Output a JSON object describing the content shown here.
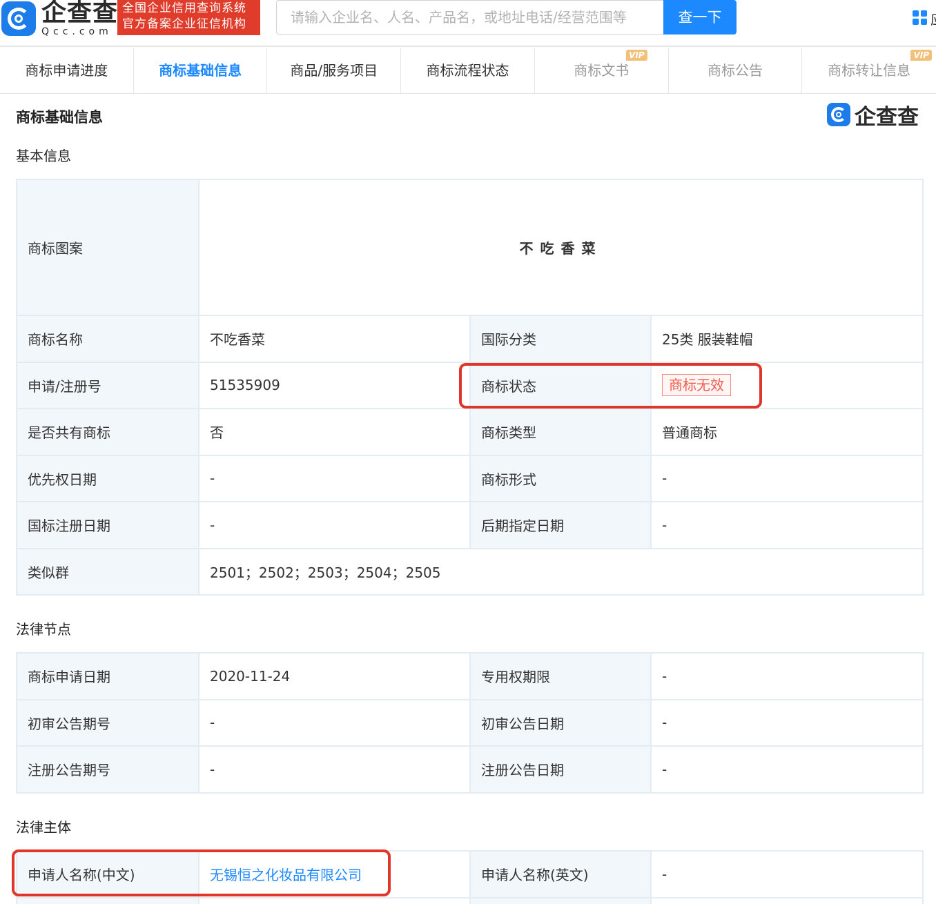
{
  "header": {
    "logo_cn": "企查查",
    "logo_en": "Qcc.com",
    "badge_line1": "全国企业信用查询系统",
    "badge_line2": "官方备案企业征信机构",
    "search_placeholder": "请输入企业名、人名、产品名，或地址电话/经营范围等",
    "search_button": "查一下",
    "cut_text": "应"
  },
  "tabs": [
    {
      "label": "商标申请进度",
      "active": false,
      "vip": false
    },
    {
      "label": "商标基础信息",
      "active": true,
      "vip": false
    },
    {
      "label": "商品/服务项目",
      "active": false,
      "vip": false
    },
    {
      "label": "商标流程状态",
      "active": false,
      "vip": false
    },
    {
      "label": "商标文书",
      "active": false,
      "vip": true
    },
    {
      "label": "商标公告",
      "active": false,
      "vip": false
    },
    {
      "label": "商标转让信息",
      "active": false,
      "vip": true
    }
  ],
  "vip_label": "VIP",
  "page": {
    "title": "商标基础信息",
    "brand_text": "企查查"
  },
  "basic": {
    "title": "基本信息",
    "trademark_image_label": "商标图案",
    "trademark_image_text": "不吃香菜",
    "rows": [
      {
        "l1": "商标名称",
        "v1": "不吃香菜",
        "l2": "国际分类",
        "v2": "25类 服装鞋帽"
      },
      {
        "l1": "申请/注册号",
        "v1": "51535909",
        "l2": "商标状态",
        "v2": "商标无效"
      },
      {
        "l1": "是否共有商标",
        "v1": "否",
        "l2": "商标类型",
        "v2": "普通商标"
      },
      {
        "l1": "优先权日期",
        "v1": "-",
        "l2": "商标形式",
        "v2": "-"
      },
      {
        "l1": "国标注册日期",
        "v1": "-",
        "l2": "后期指定日期",
        "v2": "-"
      }
    ],
    "similar_label": "类似群",
    "similar_value": "2501；2502；2503；2504；2505"
  },
  "legal_nodes": {
    "title": "法律节点",
    "rows": [
      {
        "l1": "商标申请日期",
        "v1": "2020-11-24",
        "l2": "专用权期限",
        "v2": "-"
      },
      {
        "l1": "初审公告期号",
        "v1": "-",
        "l2": "初审公告日期",
        "v2": "-"
      },
      {
        "l1": "注册公告期号",
        "v1": "-",
        "l2": "注册公告日期",
        "v2": "-"
      }
    ]
  },
  "legal_subject": {
    "title": "法律主体",
    "rows": [
      {
        "l1": "申请人名称(中文)",
        "v1": "无锡恒之化妆品有限公司",
        "l2": "申请人名称(英文)",
        "v2": "-"
      }
    ]
  },
  "colors": {
    "accent": "#1d89ff",
    "badge_red": "#e03c2c",
    "highlight_red": "#e0362a",
    "label_bg": "#f2f7fb",
    "status_red": "#ef5b4e"
  }
}
